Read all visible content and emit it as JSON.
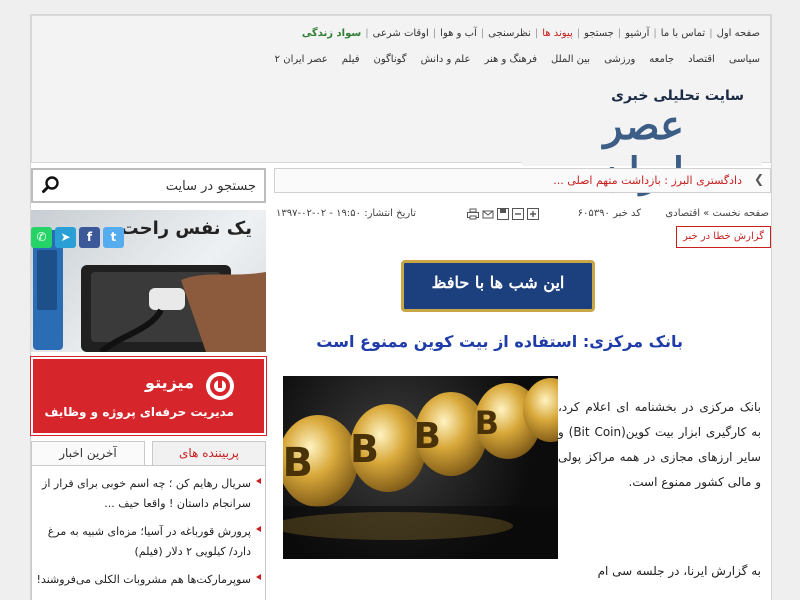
{
  "nav_top": {
    "items": [
      "صفحه اول",
      "تماس با ما",
      "آرشیو",
      "جستجو",
      "پیوند ها",
      "نظرسنجی",
      "آب و هوا",
      "اوقات شرعی"
    ],
    "highlight": "سواد زندگی"
  },
  "nav_categories": [
    "سیاسی",
    "اقتصاد",
    "جامعه",
    "ورزشی",
    "بین الملل",
    "فرهنگ و هنر",
    "علم و دانش",
    "گوناگون",
    "فیلم",
    "عصر ایران ۲"
  ],
  "logo": {
    "tagline": "سایت تحلیلی خبری",
    "name": "عصر ایران"
  },
  "search": {
    "placeholder": "جستجو در سایت"
  },
  "ticker": {
    "text": "دادگستری البرز : بازداشت متهم اصلی ..."
  },
  "article_meta": {
    "breadcrumb": "صفحه نخست » اقتصادی",
    "news_code": "کد خبر ۶۰۵۳۹۰",
    "pub_date": "تاریخ انتشار: ۱۹:۵۰ - ۰۲-۰۲-۱۳۹۷",
    "report_error": "گزارش خطا در خبر"
  },
  "hafez_banner": "این شب ها با حافظ",
  "headline": "بانک مرکزی: استفاده از بیت کوین ممنوع است",
  "body": {
    "p1": "بانک مرکزی در بخشنامه ای اعلام کرد، به کارگیری ابزار بیت کوین(Bit Coin) و سایر ارزهای مجازی در همه مراکز پولی و مالی کشور ممنوع است.",
    "p2": "به گزارش ایرنا، در جلسه سی ام"
  },
  "ads": {
    "ad1": "یک نفس راحت",
    "ad2": {
      "name": "میزیتو",
      "tagline": "مدیریت حرفه‌ای پروژه و وظایف"
    }
  },
  "tabs": {
    "popular": "پربیننده های",
    "latest": "آخرین اخبار"
  },
  "popular_news": [
    "سریال رهایم کن ؛ چه اسم خوبی برای فرار از سرانجام داستان ! واقعا حیف ...",
    "پرورش قورباغه در آسیا؛ مزه‌ای شبیه به مرغ دارد/ کیلویی ۲ دلار (فیلم)",
    "سوپرمارکت‌ها هم مشروبات الکلی می‌فروشند!"
  ],
  "colors": {
    "accent_red": "#c81e1e",
    "headline_blue": "#1f3ca8",
    "logo_blue": "#3b5d86",
    "ad_red": "#d6262b"
  }
}
